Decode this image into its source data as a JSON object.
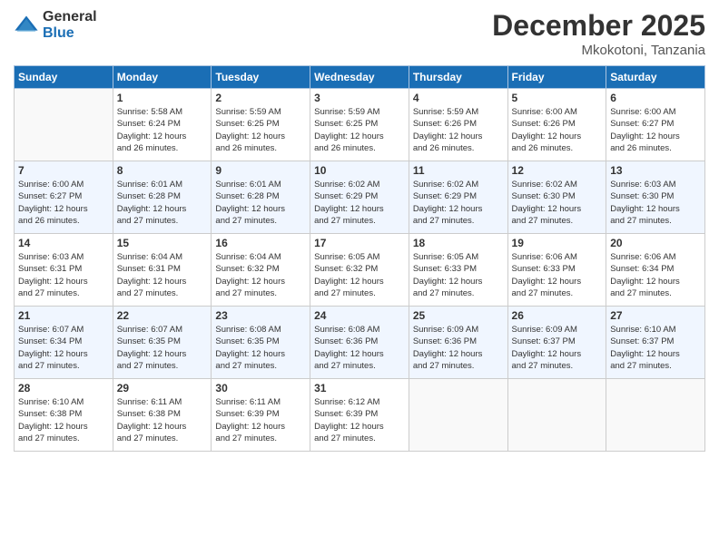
{
  "logo": {
    "general": "General",
    "blue": "Blue"
  },
  "title": "December 2025",
  "location": "Mkokotoni, Tanzania",
  "days_of_week": [
    "Sunday",
    "Monday",
    "Tuesday",
    "Wednesday",
    "Thursday",
    "Friday",
    "Saturday"
  ],
  "weeks": [
    [
      {
        "day": "",
        "sunrise": "",
        "sunset": "",
        "daylight": ""
      },
      {
        "day": "1",
        "sunrise": "Sunrise: 5:58 AM",
        "sunset": "Sunset: 6:24 PM",
        "daylight": "Daylight: 12 hours and 26 minutes."
      },
      {
        "day": "2",
        "sunrise": "Sunrise: 5:59 AM",
        "sunset": "Sunset: 6:25 PM",
        "daylight": "Daylight: 12 hours and 26 minutes."
      },
      {
        "day": "3",
        "sunrise": "Sunrise: 5:59 AM",
        "sunset": "Sunset: 6:25 PM",
        "daylight": "Daylight: 12 hours and 26 minutes."
      },
      {
        "day": "4",
        "sunrise": "Sunrise: 5:59 AM",
        "sunset": "Sunset: 6:26 PM",
        "daylight": "Daylight: 12 hours and 26 minutes."
      },
      {
        "day": "5",
        "sunrise": "Sunrise: 6:00 AM",
        "sunset": "Sunset: 6:26 PM",
        "daylight": "Daylight: 12 hours and 26 minutes."
      },
      {
        "day": "6",
        "sunrise": "Sunrise: 6:00 AM",
        "sunset": "Sunset: 6:27 PM",
        "daylight": "Daylight: 12 hours and 26 minutes."
      }
    ],
    [
      {
        "day": "7",
        "sunrise": "Sunrise: 6:00 AM",
        "sunset": "Sunset: 6:27 PM",
        "daylight": "Daylight: 12 hours and 26 minutes."
      },
      {
        "day": "8",
        "sunrise": "Sunrise: 6:01 AM",
        "sunset": "Sunset: 6:28 PM",
        "daylight": "Daylight: 12 hours and 27 minutes."
      },
      {
        "day": "9",
        "sunrise": "Sunrise: 6:01 AM",
        "sunset": "Sunset: 6:28 PM",
        "daylight": "Daylight: 12 hours and 27 minutes."
      },
      {
        "day": "10",
        "sunrise": "Sunrise: 6:02 AM",
        "sunset": "Sunset: 6:29 PM",
        "daylight": "Daylight: 12 hours and 27 minutes."
      },
      {
        "day": "11",
        "sunrise": "Sunrise: 6:02 AM",
        "sunset": "Sunset: 6:29 PM",
        "daylight": "Daylight: 12 hours and 27 minutes."
      },
      {
        "day": "12",
        "sunrise": "Sunrise: 6:02 AM",
        "sunset": "Sunset: 6:30 PM",
        "daylight": "Daylight: 12 hours and 27 minutes."
      },
      {
        "day": "13",
        "sunrise": "Sunrise: 6:03 AM",
        "sunset": "Sunset: 6:30 PM",
        "daylight": "Daylight: 12 hours and 27 minutes."
      }
    ],
    [
      {
        "day": "14",
        "sunrise": "Sunrise: 6:03 AM",
        "sunset": "Sunset: 6:31 PM",
        "daylight": "Daylight: 12 hours and 27 minutes."
      },
      {
        "day": "15",
        "sunrise": "Sunrise: 6:04 AM",
        "sunset": "Sunset: 6:31 PM",
        "daylight": "Daylight: 12 hours and 27 minutes."
      },
      {
        "day": "16",
        "sunrise": "Sunrise: 6:04 AM",
        "sunset": "Sunset: 6:32 PM",
        "daylight": "Daylight: 12 hours and 27 minutes."
      },
      {
        "day": "17",
        "sunrise": "Sunrise: 6:05 AM",
        "sunset": "Sunset: 6:32 PM",
        "daylight": "Daylight: 12 hours and 27 minutes."
      },
      {
        "day": "18",
        "sunrise": "Sunrise: 6:05 AM",
        "sunset": "Sunset: 6:33 PM",
        "daylight": "Daylight: 12 hours and 27 minutes."
      },
      {
        "day": "19",
        "sunrise": "Sunrise: 6:06 AM",
        "sunset": "Sunset: 6:33 PM",
        "daylight": "Daylight: 12 hours and 27 minutes."
      },
      {
        "day": "20",
        "sunrise": "Sunrise: 6:06 AM",
        "sunset": "Sunset: 6:34 PM",
        "daylight": "Daylight: 12 hours and 27 minutes."
      }
    ],
    [
      {
        "day": "21",
        "sunrise": "Sunrise: 6:07 AM",
        "sunset": "Sunset: 6:34 PM",
        "daylight": "Daylight: 12 hours and 27 minutes."
      },
      {
        "day": "22",
        "sunrise": "Sunrise: 6:07 AM",
        "sunset": "Sunset: 6:35 PM",
        "daylight": "Daylight: 12 hours and 27 minutes."
      },
      {
        "day": "23",
        "sunrise": "Sunrise: 6:08 AM",
        "sunset": "Sunset: 6:35 PM",
        "daylight": "Daylight: 12 hours and 27 minutes."
      },
      {
        "day": "24",
        "sunrise": "Sunrise: 6:08 AM",
        "sunset": "Sunset: 6:36 PM",
        "daylight": "Daylight: 12 hours and 27 minutes."
      },
      {
        "day": "25",
        "sunrise": "Sunrise: 6:09 AM",
        "sunset": "Sunset: 6:36 PM",
        "daylight": "Daylight: 12 hours and 27 minutes."
      },
      {
        "day": "26",
        "sunrise": "Sunrise: 6:09 AM",
        "sunset": "Sunset: 6:37 PM",
        "daylight": "Daylight: 12 hours and 27 minutes."
      },
      {
        "day": "27",
        "sunrise": "Sunrise: 6:10 AM",
        "sunset": "Sunset: 6:37 PM",
        "daylight": "Daylight: 12 hours and 27 minutes."
      }
    ],
    [
      {
        "day": "28",
        "sunrise": "Sunrise: 6:10 AM",
        "sunset": "Sunset: 6:38 PM",
        "daylight": "Daylight: 12 hours and 27 minutes."
      },
      {
        "day": "29",
        "sunrise": "Sunrise: 6:11 AM",
        "sunset": "Sunset: 6:38 PM",
        "daylight": "Daylight: 12 hours and 27 minutes."
      },
      {
        "day": "30",
        "sunrise": "Sunrise: 6:11 AM",
        "sunset": "Sunset: 6:39 PM",
        "daylight": "Daylight: 12 hours and 27 minutes."
      },
      {
        "day": "31",
        "sunrise": "Sunrise: 6:12 AM",
        "sunset": "Sunset: 6:39 PM",
        "daylight": "Daylight: 12 hours and 27 minutes."
      },
      {
        "day": "",
        "sunrise": "",
        "sunset": "",
        "daylight": ""
      },
      {
        "day": "",
        "sunrise": "",
        "sunset": "",
        "daylight": ""
      },
      {
        "day": "",
        "sunrise": "",
        "sunset": "",
        "daylight": ""
      }
    ]
  ]
}
